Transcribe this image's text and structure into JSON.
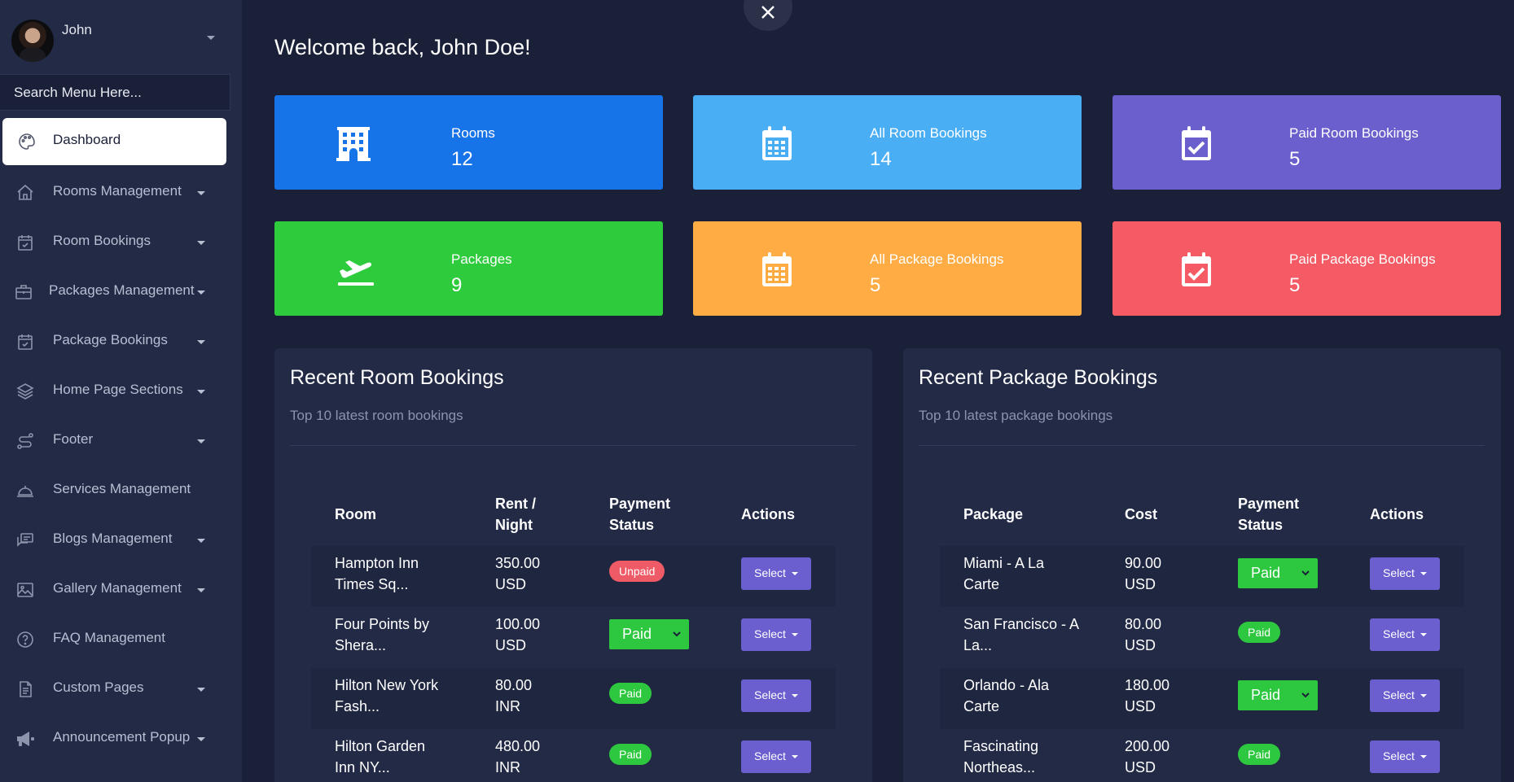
{
  "user": {
    "name": "John"
  },
  "search_menu": {
    "placeholder": "Search Menu Here..."
  },
  "sidebar": {
    "items": [
      {
        "label": "Dashboard",
        "icon": "palette-icon",
        "active": true,
        "has_submenu": false
      },
      {
        "label": "Rooms Management",
        "icon": "home-icon",
        "has_submenu": true
      },
      {
        "label": "Room Bookings",
        "icon": "calendar-check-icon",
        "has_submenu": true
      },
      {
        "label": "Packages Management",
        "icon": "briefcase-icon",
        "has_submenu": true
      },
      {
        "label": "Package Bookings",
        "icon": "calendar-check-icon",
        "has_submenu": true
      },
      {
        "label": "Home Page Sections",
        "icon": "layers-icon",
        "has_submenu": true
      },
      {
        "label": "Footer",
        "icon": "route-icon",
        "has_submenu": true
      },
      {
        "label": "Services Management",
        "icon": "bell-service-icon",
        "has_submenu": false
      },
      {
        "label": "Blogs Management",
        "icon": "chat-icon",
        "has_submenu": true
      },
      {
        "label": "Gallery Management",
        "icon": "image-icon",
        "has_submenu": true
      },
      {
        "label": "FAQ Management",
        "icon": "question-icon",
        "has_submenu": false
      },
      {
        "label": "Custom Pages",
        "icon": "file-icon",
        "has_submenu": true
      },
      {
        "label": "Announcement Popup",
        "icon": "megaphone-icon",
        "has_submenu": true
      }
    ]
  },
  "welcome": "Welcome back, John Doe!",
  "cards": [
    {
      "label": "Rooms",
      "value": "12",
      "icon": "building-icon",
      "color": "#1773e8"
    },
    {
      "label": "All Room Bookings",
      "value": "14",
      "icon": "calendar-icon",
      "color": "#4aaef5"
    },
    {
      "label": "Paid Room Bookings",
      "value": "5",
      "icon": "calendar-check-icon",
      "color": "#6a5fcc"
    },
    {
      "label": "Packages",
      "value": "9",
      "icon": "plane-departure-icon",
      "color": "#2ecb3c"
    },
    {
      "label": "All Package Bookings",
      "value": "5",
      "icon": "calendar-icon",
      "color": "#ffac45"
    },
    {
      "label": "Paid Package Bookings",
      "value": "5",
      "icon": "calendar-check-icon",
      "color": "#f45b65"
    }
  ],
  "room_panel": {
    "title": "Recent Room Bookings",
    "subtitle": "Top 10 latest room bookings",
    "headers": {
      "item": "Room",
      "price_line1": "Rent /",
      "price_line2": "Night",
      "status_line1": "Payment",
      "status_line2": "Status",
      "actions": "Actions"
    },
    "rows": [
      {
        "name1": "Hampton Inn",
        "name2": "Times Sq...",
        "price1": "350.00",
        "price2": "USD",
        "status": "Unpaid",
        "status_type": "badge-unpaid",
        "action": "Select"
      },
      {
        "name1": "Four Points by",
        "name2": "Shera...",
        "price1": "100.00",
        "price2": "USD",
        "status": "Paid",
        "status_type": "select",
        "action": "Select"
      },
      {
        "name1": "Hilton New York",
        "name2": "Fash...",
        "price1": "80.00",
        "price2": "INR",
        "status": "Paid",
        "status_type": "badge-paid",
        "action": "Select"
      },
      {
        "name1": "Hilton Garden",
        "name2": "Inn NY...",
        "price1": "480.00",
        "price2": "INR",
        "status": "Paid",
        "status_type": "badge-paid",
        "action": "Select"
      }
    ]
  },
  "package_panel": {
    "title": "Recent Package Bookings",
    "subtitle": "Top 10 latest package bookings",
    "headers": {
      "item": "Package",
      "price": "Cost",
      "status_line1": "Payment",
      "status_line2": "Status",
      "actions": "Actions"
    },
    "rows": [
      {
        "name1": "Miami - A La",
        "name2": "Carte",
        "price1": "90.00",
        "price2": "USD",
        "status": "Paid",
        "status_type": "select",
        "action": "Select"
      },
      {
        "name1": "San Francisco - A",
        "name2": "La...",
        "price1": "80.00",
        "price2": "USD",
        "status": "Paid",
        "status_type": "badge-paid",
        "action": "Select"
      },
      {
        "name1": "Orlando - Ala",
        "name2": "Carte",
        "price1": "180.00",
        "price2": "USD",
        "status": "Paid",
        "status_type": "select",
        "action": "Select"
      },
      {
        "name1": "Fascinating",
        "name2": "Northeas...",
        "price1": "200.00",
        "price2": "USD",
        "status": "Paid",
        "status_type": "badge-paid",
        "action": "Select"
      }
    ]
  }
}
